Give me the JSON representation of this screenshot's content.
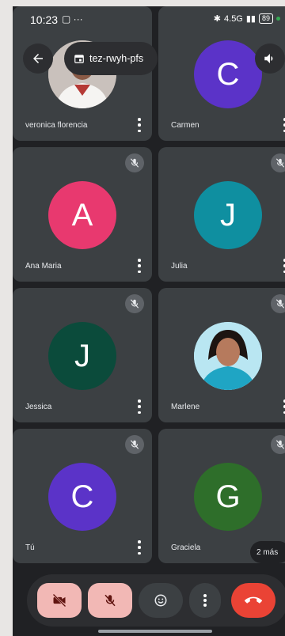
{
  "status": {
    "time": "10:23",
    "extra": "▢ ···",
    "network": "4.5G",
    "battery": "89"
  },
  "meeting": {
    "code": "tez-rwyh-pfs"
  },
  "colors": {
    "tile": "#3c4043",
    "end": "#ea4335",
    "camOff": "#f2b8b5"
  },
  "tiles": [
    {
      "name": "veronica florencia",
      "kind": "photo",
      "muted": false
    },
    {
      "name": "Carmen",
      "initial": "C",
      "color": "#5b33c8",
      "muted": false
    },
    {
      "name": "Ana Maria",
      "initial": "A",
      "color": "#e8396f",
      "muted": true
    },
    {
      "name": "Julia",
      "initial": "J",
      "color": "#0f8fa0",
      "muted": true
    },
    {
      "name": "Jessica",
      "initial": "J",
      "color": "#0b4b3b",
      "muted": true
    },
    {
      "name": "Marlene",
      "kind": "photo",
      "muted": true
    },
    {
      "name": "Tú",
      "initial": "C",
      "color": "#5b33c8",
      "muted": true
    },
    {
      "name": "Graciela",
      "initial": "G",
      "color": "#2e6e2a",
      "muted": true
    }
  ],
  "more_participants": "2 más",
  "icons": [
    "back-arrow-icon",
    "calendar-icon",
    "speaker-icon",
    "mic-off-icon",
    "camera-off-icon",
    "emoji-icon",
    "more-vert-icon",
    "call-end-icon"
  ]
}
